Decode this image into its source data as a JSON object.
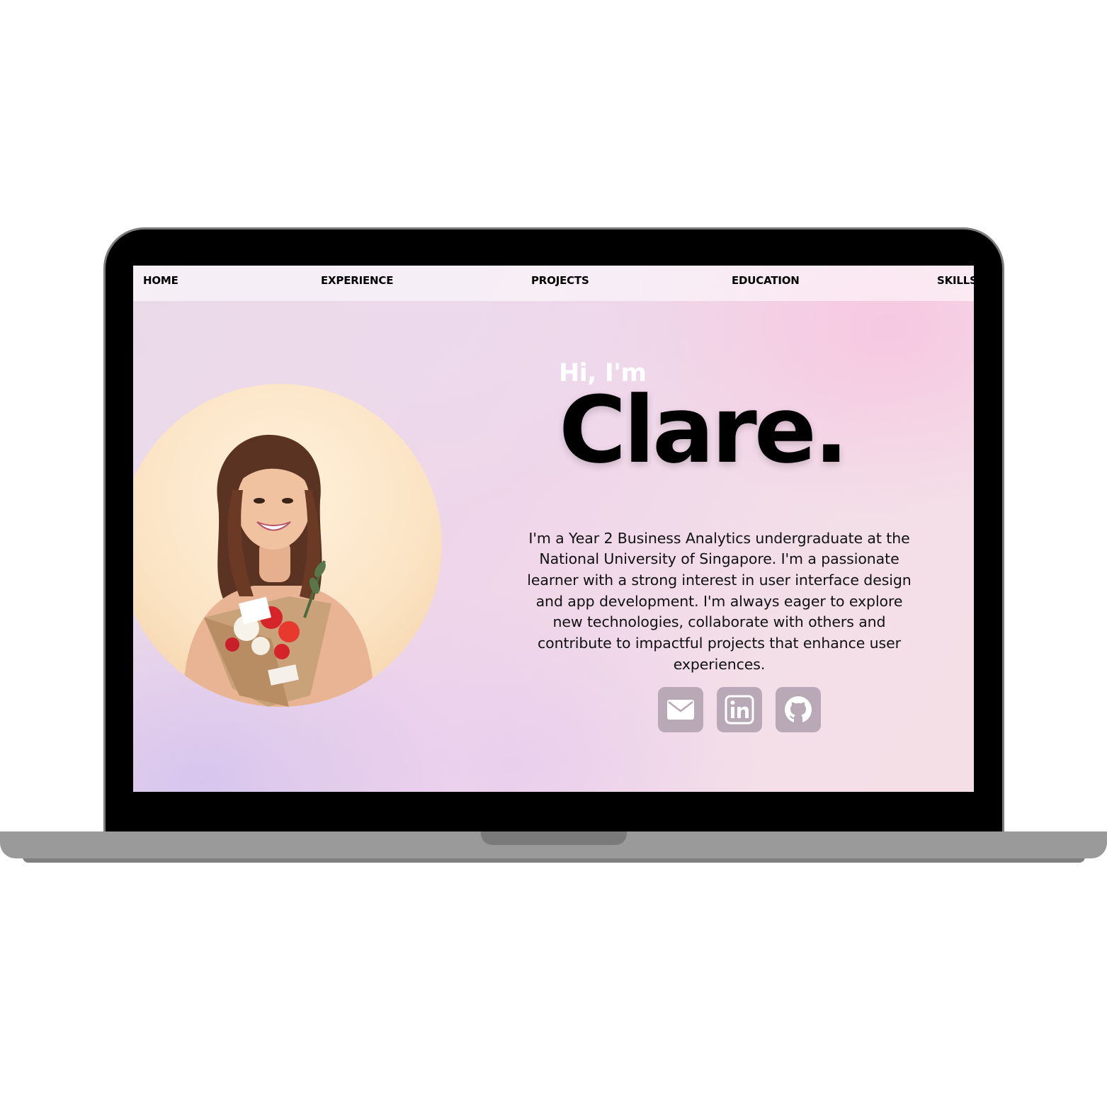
{
  "nav": {
    "items": [
      {
        "label": "HOME"
      },
      {
        "label": "EXPERIENCE"
      },
      {
        "label": "PROJECTS"
      },
      {
        "label": "EDUCATION"
      },
      {
        "label": "SKILLS"
      }
    ]
  },
  "hero": {
    "greeting": "Hi, I'm",
    "name": "Clare.",
    "bio": "I'm a Year 2 Business Analytics undergraduate at the National University of Singapore. I'm a passionate learner with a strong interest in user interface design and app development. I'm always eager to explore new technologies, collaborate with others and contribute to impactful projects that enhance user experiences."
  },
  "portrait": {
    "icon": "profile-photo"
  },
  "socials": [
    {
      "icon": "mail-icon"
    },
    {
      "icon": "linkedin-icon"
    },
    {
      "icon": "github-icon"
    }
  ],
  "colors": {
    "social_bg": "#b9a9b6",
    "text": "#000000",
    "greeting": "#ffffff"
  }
}
